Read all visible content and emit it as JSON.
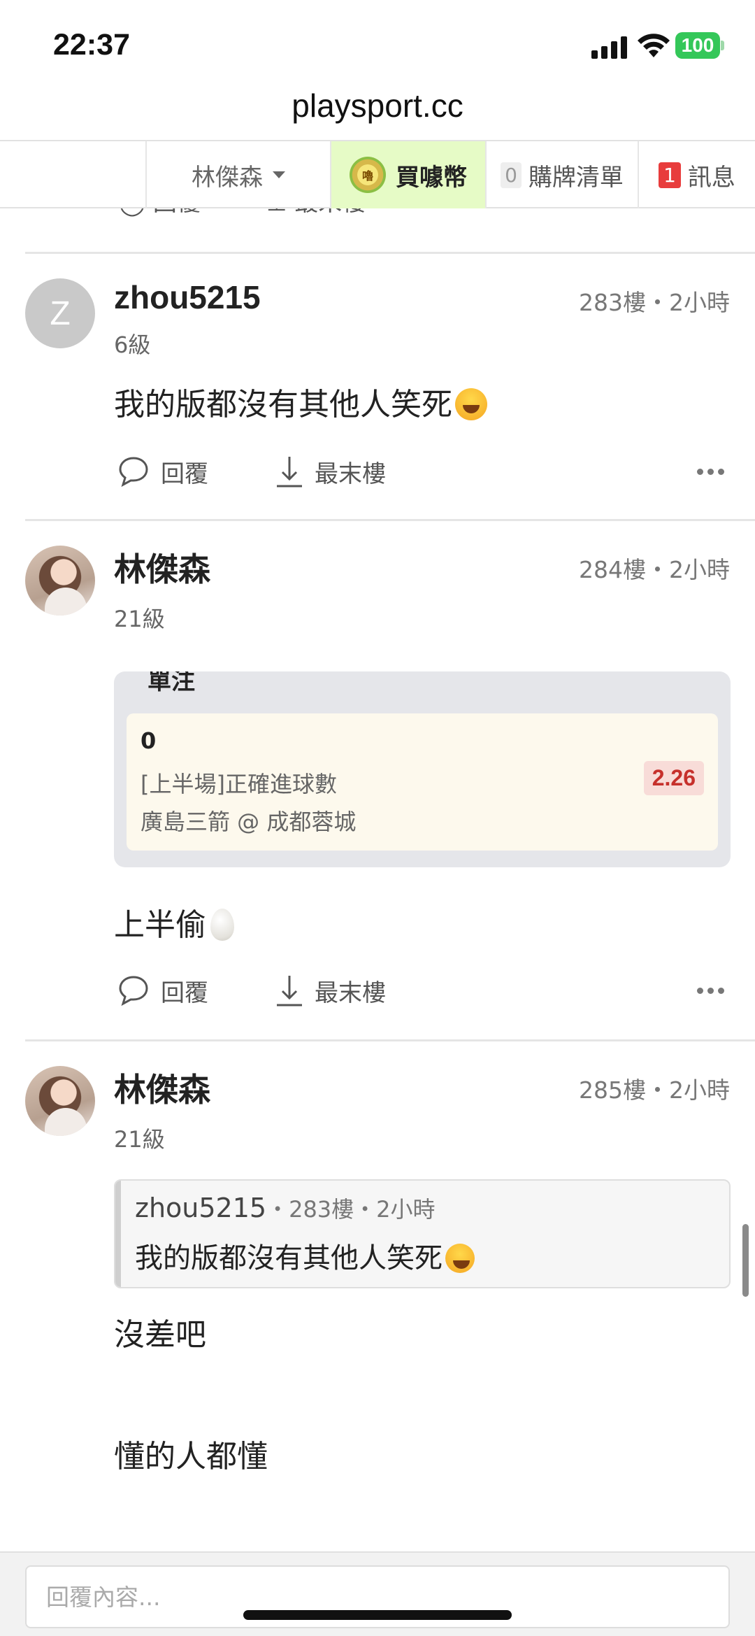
{
  "status_bar": {
    "time": "22:37",
    "battery": "100"
  },
  "browser": {
    "url": "playsport.cc"
  },
  "nav": {
    "user": "林傑森",
    "coin_icon_text": "嚕",
    "coin_label": "買噱幣",
    "cart_count": "0",
    "cart_label": "購牌清單",
    "msg_count": "1",
    "msg_label": "訊息"
  },
  "actions": {
    "reply_label": "回覆",
    "last_label": "最末樓"
  },
  "posts": [
    {
      "avatar_letter": "Z",
      "name": "zhou5215",
      "level": "6級",
      "meta": "283樓・2小時",
      "text": "我的版都沒有其他人笑死"
    },
    {
      "name": "林傑森",
      "level": "21級",
      "meta": "284樓・2小時",
      "bet": {
        "header": "單注",
        "value": "0",
        "type": "[上半場]正確進球數",
        "match": "廣島三箭 @ 成都蓉城",
        "odds": "2.26"
      },
      "text": "上半偷"
    },
    {
      "name": "林傑森",
      "level": "21級",
      "meta": "285樓・2小時",
      "quote": {
        "author": "zhou5215",
        "meta": "・283樓・2小時",
        "text": "我的版都沒有其他人笑死"
      },
      "text_line1": "沒差吧",
      "text_line2": "懂的人都懂"
    }
  ],
  "reply_box": {
    "placeholder": "回覆內容..."
  }
}
